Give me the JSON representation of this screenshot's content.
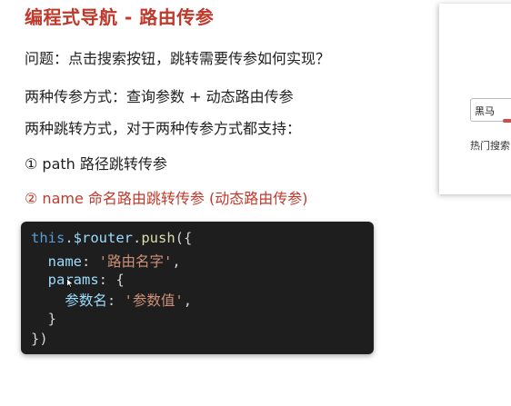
{
  "slide": {
    "title": "编程式导航 - 路由传参",
    "question": "问题：点击搜索按钮，跳转需要传参如何实现？",
    "two_param_ways": "两种传参方式：查询参数 + 动态路由传参",
    "two_jump_ways": "两种跳转方式，对于两种传参方式都支持：",
    "way_path": "① path 路径跳转传参",
    "way_name": "② name 命名路由跳转传参 (动态路由传参)"
  },
  "code": {
    "l1": {
      "this": "this",
      "router": ".$router",
      "dot": ".",
      "push": "push",
      "open": "({"
    },
    "l2": {
      "indent": "  ",
      "key": "name",
      "colon": ": ",
      "value": "'路由名字'",
      "comma": ","
    },
    "l3": {
      "indent": "  ",
      "key": "params",
      "rest": ": {"
    },
    "l4": {
      "indent": "    ",
      "key": "参数名",
      "colon": ": ",
      "value": "'参数值'",
      "comma": ","
    },
    "l5": "  }",
    "l6": "})"
  },
  "preview": {
    "search_value": "黑马",
    "hot_label": "热门搜索",
    "accent_color": "#d24b4b"
  },
  "colors": {
    "title": "#c0392b",
    "code_bg": "#1e1e1e"
  }
}
